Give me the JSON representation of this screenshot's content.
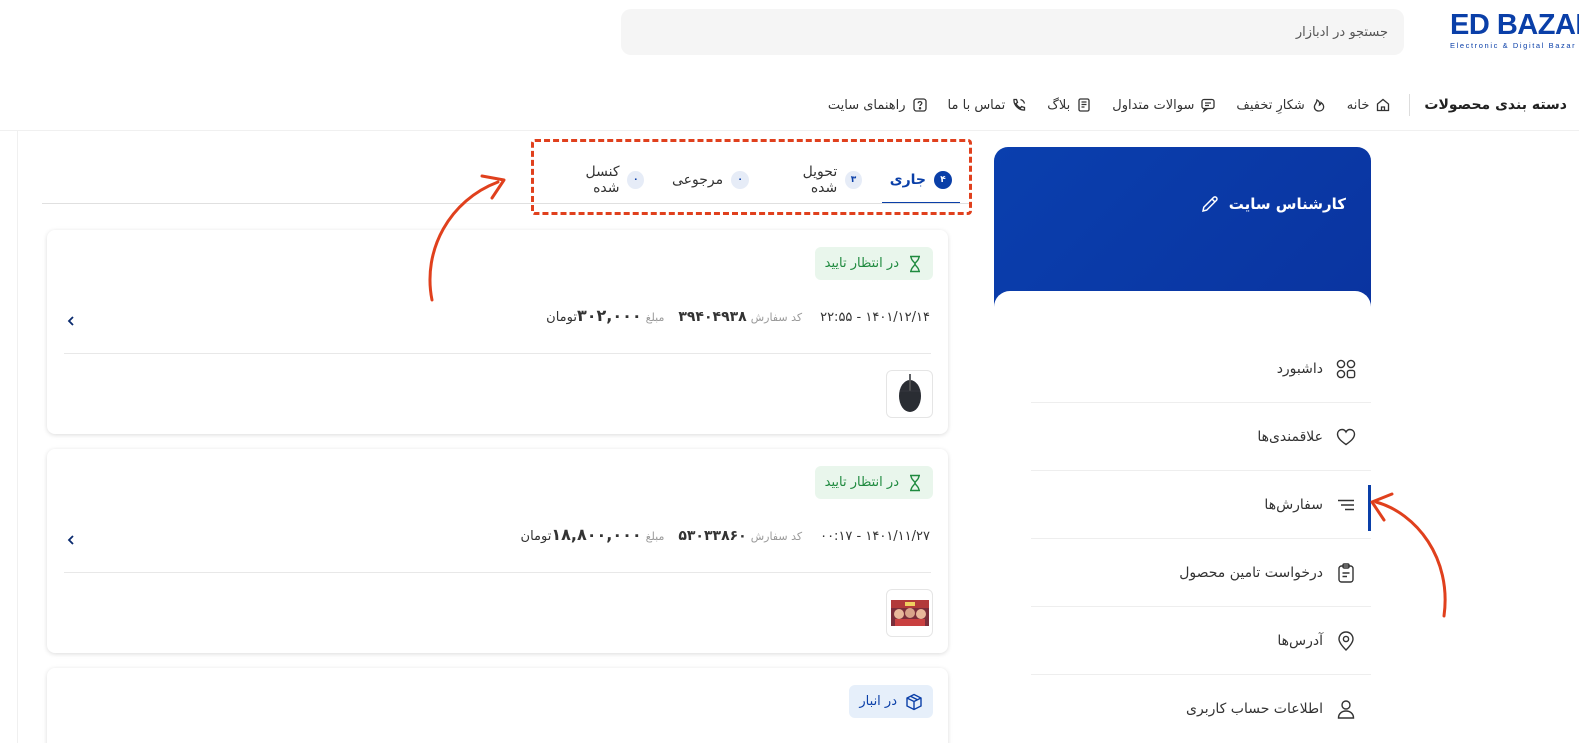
{
  "header": {
    "logo_text": "ED BAZAR",
    "logo_sub": "Electronic & Digital Bazar",
    "search_placeholder": "جستجو در ادبازار"
  },
  "nav": {
    "categories": "دسته بندی محصولات",
    "items": [
      {
        "label": "خانه",
        "icon": "home-icon"
      },
      {
        "label": "شکارِ تخفیف",
        "icon": "fire-icon"
      },
      {
        "label": "سوالات متداول",
        "icon": "chat-icon"
      },
      {
        "label": "بلاگ",
        "icon": "book-icon"
      },
      {
        "label": "تماس با ما",
        "icon": "phone-icon"
      },
      {
        "label": "راهنمای سایت",
        "icon": "help-icon"
      }
    ]
  },
  "sidebar": {
    "user_name": "کارشناس سایت",
    "items": [
      {
        "label": "داشبورد",
        "icon": "dashboard-icon"
      },
      {
        "label": "علاقمندی‌ها",
        "icon": "heart-icon"
      },
      {
        "label": "سفارش‌ها",
        "icon": "orders-icon",
        "active": true
      },
      {
        "label": "درخواست تامین محصول",
        "icon": "clipboard-icon"
      },
      {
        "label": "آدرس‌ها",
        "icon": "location-icon"
      },
      {
        "label": "اطلاعات حساب کاربری",
        "icon": "user-icon"
      }
    ]
  },
  "tabs": [
    {
      "label": "جاری",
      "count": "۴",
      "active": true
    },
    {
      "label": "تحویل شده",
      "count": "۳"
    },
    {
      "label": "مرجوعی",
      "count": "۰"
    },
    {
      "label": "کنسل شده",
      "count": "۰"
    }
  ],
  "orders": [
    {
      "status": "در انتظار تایید",
      "datetime": "۱۴۰۱/۱۲/۱۴ - ۲۲:۵۵",
      "code_label": "کد سفارش",
      "code": "۳۹۴۰۴۹۳۸",
      "amount_label": "مبلغ",
      "amount": "۳۰۲,۰۰۰",
      "currency": "تومان"
    },
    {
      "status": "در انتظار تایید",
      "datetime": "۱۴۰۱/۱۱/۲۷ - ۰۰:۱۷",
      "code_label": "کد سفارش",
      "code": "۵۳۰۳۳۸۶۰",
      "amount_label": "مبلغ",
      "amount": "۱۸,۸۰۰,۰۰۰",
      "currency": "تومان"
    },
    {
      "status": "در انبار"
    }
  ],
  "colors": {
    "brand": "#0a3fa8",
    "annotation": "#e0401d",
    "status_wait": "#1f8a3f",
    "status_wait_bg": "#e9f6ec"
  }
}
